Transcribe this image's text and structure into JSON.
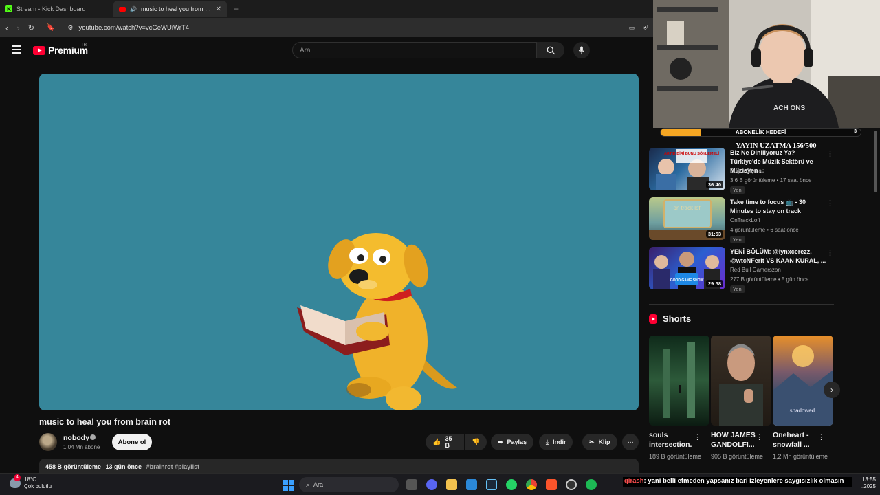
{
  "browser": {
    "tabs": [
      {
        "label": "Stream - Kick Dashboard",
        "icon": "kick-icon"
      },
      {
        "label": "music to heal you from brain rot",
        "icon": "youtube-icon"
      }
    ],
    "url": "youtube.com/watch?v=vcGeWUiWrT4"
  },
  "youtube": {
    "logo_text": "Premium",
    "logo_region": "TR",
    "search_placeholder": "Ara"
  },
  "video": {
    "title": "music to heal you from brain rot",
    "channel": "nobody",
    "subscribers": "1,04 Mn abone",
    "subscribe_label": "Abone ol",
    "likes": "35 B",
    "share_label": "Paylaş",
    "download_label": "İndir",
    "clip_label": "Klip",
    "views": "458 B görüntüleme",
    "age": "13 gün önce",
    "tags": "#brainrot #playlist",
    "bg_color": "#36869a"
  },
  "overlay": {
    "goal_label": "ABONELİK HEDEFİ",
    "goal_count": "3",
    "goal_progress": 0.2,
    "extension_text": "YAYIN UZATMA 156/500"
  },
  "recommendations": [
    {
      "title": "Biz Ne Diniliyoruz Ya? Türkiye'de Müzik Sektörü ve Müzisyen ...",
      "channel": "Buğra Şişman",
      "meta": "3,6 B görüntüleme • 17 saat önce",
      "badge": "Yeni",
      "duration": "36:40",
      "thumb_text": "ARTIK BİRİ BUNU SÖYLEMELİ"
    },
    {
      "title": "Take time to focus 📺 - 30 Minutes to stay on track",
      "channel": "OnTrackLofi",
      "meta": "4 görüntüleme • 6 saat önce",
      "badge": "Yeni",
      "duration": "31:53",
      "thumb_text": "on track lofi"
    },
    {
      "title": "YENİ BÖLÜM: @lynxcerezz, @wtcNFerit VS KAAN KURAL, ...",
      "channel": "Red Bull Gamerszon",
      "meta": "277 B görüntüleme • 5 gün önce",
      "badge": "Yeni",
      "duration": "29:58",
      "thumb_text": "GOOD GAME SHOW"
    }
  ],
  "shorts": {
    "heading": "Shorts",
    "items": [
      {
        "title": "souls intersection.",
        "views": "189 B görüntüleme"
      },
      {
        "title": "HOW JAMES GANDOLFI...",
        "views": "905 B görüntüleme"
      },
      {
        "title": "Oneheart - snowfall ...",
        "views": "1,2 Mn görüntüleme",
        "thumb_text": "shadowed."
      }
    ]
  },
  "taskbar": {
    "temp": "18°C",
    "weather": "Çok bulutlu",
    "search": "Ara",
    "time": "13:55",
    "date": "..2025"
  },
  "chat": {
    "user": "qirash",
    "message": ": yani belli etmeden yapsanız bari izleyenlere saygısızlık olmasın"
  }
}
